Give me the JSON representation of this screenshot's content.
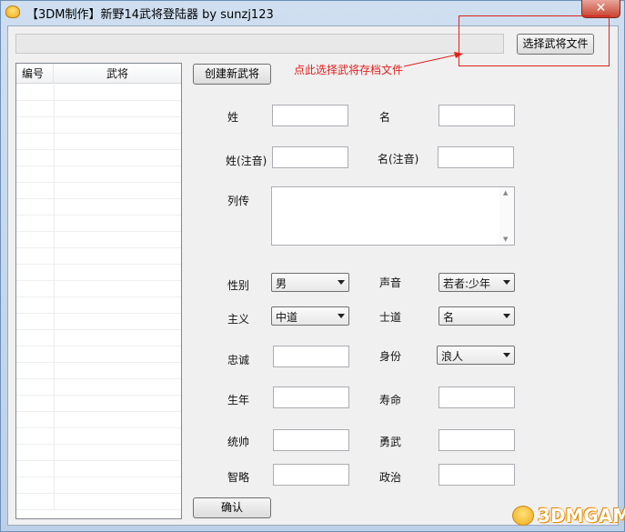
{
  "window": {
    "title": "【3DM制作】新野14武将登陆器 by sunzj123",
    "close": "✕"
  },
  "toolbar": {
    "select_file_button": "选择武将文件",
    "create_button": "创建新武将",
    "confirm_button": "确认"
  },
  "annotation": {
    "text": "点此选择武将存档文件",
    "color": "#e0201c"
  },
  "list": {
    "columns": [
      "编号",
      "武将"
    ],
    "rows": []
  },
  "form": {
    "surname": "姓",
    "given_name": "名",
    "surname_phonetic": "姓(注音)",
    "given_phonetic": "名(注音)",
    "biography": "列传",
    "gender": {
      "label": "性别",
      "value": "男"
    },
    "voice": {
      "label": "声音",
      "value": "若者:少年"
    },
    "ideology": {
      "label": "主义",
      "value": "中道"
    },
    "code": {
      "label": "士道",
      "value": "名"
    },
    "loyalty": "忠诚",
    "status": {
      "label": "身份",
      "value": "浪人"
    },
    "birth_year": "生年",
    "lifespan": "寿命",
    "command": "统帅",
    "valor": "勇武",
    "intellect": "智略",
    "politics": "政治"
  },
  "watermark": {
    "text": "3DMGAME",
    "icon": "mascot-icon"
  }
}
